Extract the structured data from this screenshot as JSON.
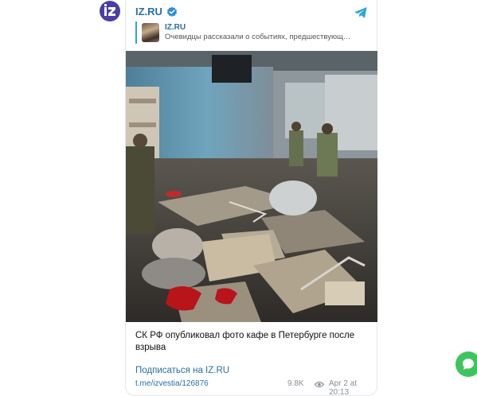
{
  "channel": {
    "name": "IZ.RU",
    "avatar_text": "iz",
    "verified_icon": "verified-badge-icon",
    "telegram_icon": "telegram-plane-icon"
  },
  "reply": {
    "name": "IZ.RU",
    "text": "Очевидцы рассказали о событиях, предшествующ…"
  },
  "post": {
    "photo_alt": "photo",
    "caption": "СК РФ опубликовал фото кафе в Петербурге после взрыва",
    "subscribe": "Подписаться на IZ.RU",
    "link": "t.me/izvestia/126876",
    "views": "9.8K",
    "date": "Apr 2 at 20:13"
  },
  "colors": {
    "brand": "#4b3fa3",
    "link": "#2b6ea3",
    "accent_bar": "#2ea6da",
    "fab": "#3ec45e"
  }
}
